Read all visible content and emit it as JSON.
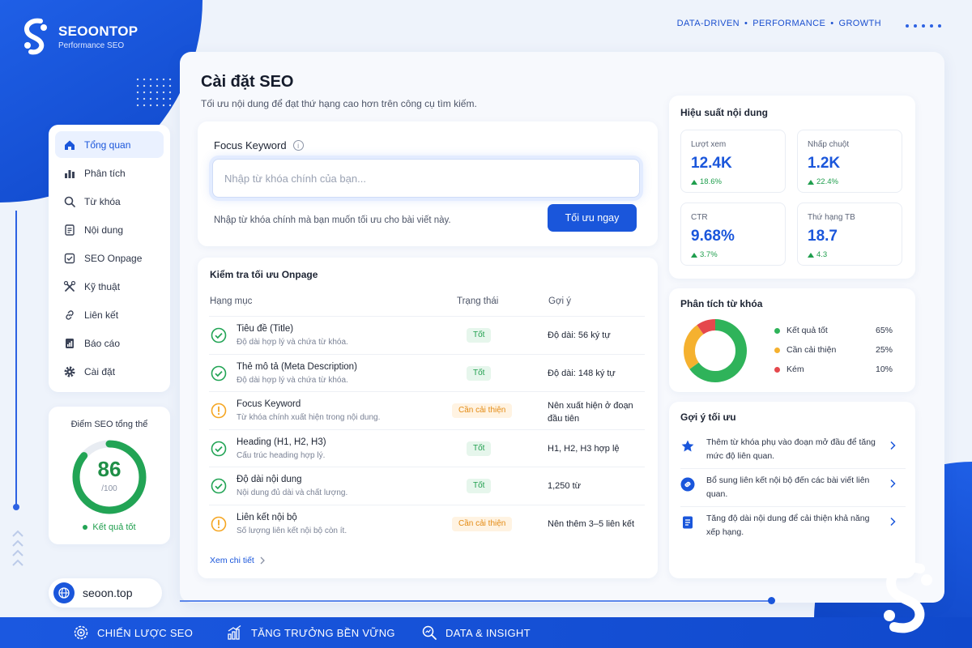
{
  "brand": {
    "name": "SEOONTOP",
    "subtitle": "Performance SEO"
  },
  "tagline": {
    "items": [
      "DATA-DRIVEN",
      "PERFORMANCE",
      "GROWTH"
    ],
    "separator": "•"
  },
  "sidebar": {
    "items": [
      {
        "label": "Tổng quan",
        "icon": "home-icon",
        "active": true
      },
      {
        "label": "Phân tích",
        "icon": "bar-chart-icon"
      },
      {
        "label": "Từ khóa",
        "icon": "search-icon"
      },
      {
        "label": "Nội dung",
        "icon": "document-icon"
      },
      {
        "label": "SEO Onpage",
        "icon": "checklist-icon"
      },
      {
        "label": "Kỹ thuật",
        "icon": "tools-icon"
      },
      {
        "label": "Liên kết",
        "icon": "link-icon"
      },
      {
        "label": "Báo cáo",
        "icon": "report-icon"
      },
      {
        "label": "Cài đặt",
        "icon": "gear-icon"
      }
    ]
  },
  "score": {
    "title": "Điểm SEO tổng thể",
    "value": "86",
    "max": "/100",
    "percent": 86,
    "status": "Kết quả tốt"
  },
  "site": {
    "label": "seoon.top"
  },
  "page": {
    "title": "Cài đặt SEO",
    "subtitle": "Tối ưu nội dung để đạt thứ hạng cao hơn trên công cụ tìm kiếm."
  },
  "keyword": {
    "label": "Focus Keyword",
    "info": "i",
    "placeholder": "Nhập từ khóa chính của bạn...",
    "value": "",
    "hint": "Nhập từ khóa chính mà bạn muốn tối ưu cho bài viết này.",
    "button": "Tối ưu ngay"
  },
  "onpage": {
    "title": "Kiểm tra tối ưu Onpage",
    "headers": {
      "item": "Hạng mục",
      "status": "Trạng thái",
      "suggestion": "Gợi ý"
    },
    "rows": [
      {
        "name": "Tiêu đề (Title)",
        "desc": "Độ dài hợp lý và chứa từ khóa.",
        "status": "Tốt",
        "state": "good",
        "hint": "Độ dài: 56 ký tự"
      },
      {
        "name": "Thẻ mô tả (Meta Description)",
        "desc": "Độ dài hợp lý và chứa từ khóa.",
        "status": "Tốt",
        "state": "good",
        "hint": "Độ dài: 148 ký tự"
      },
      {
        "name": "Focus Keyword",
        "desc": "Từ khóa chính xuất hiện trong nội dung.",
        "status": "Cần cải thiện",
        "state": "warn",
        "hint": "Nên xuất hiện ở đoạn đầu tiên"
      },
      {
        "name": "Heading (H1, H2, H3)",
        "desc": "Cấu trúc heading hợp lý.",
        "status": "Tốt",
        "state": "good",
        "hint": "H1, H2, H3 hợp lệ"
      },
      {
        "name": "Độ dài nội dung",
        "desc": "Nội dung đủ dài và chất lượng.",
        "status": "Tốt",
        "state": "good",
        "hint": "1,250 từ"
      },
      {
        "name": "Liên kết nội bộ",
        "desc": "Số lượng liên kết nội bộ còn ít.",
        "status": "Cần cải thiện",
        "state": "warn",
        "hint": "Nên thêm 3–5 liên kết"
      }
    ],
    "see_more": "Xem chi tiết"
  },
  "performance": {
    "title": "Hiệu suất nội dung",
    "stats": [
      {
        "label": "Lượt xem",
        "value": "12.4K",
        "delta": "18.6%"
      },
      {
        "label": "Nhấp chuột",
        "value": "1.2K",
        "delta": "22.4%"
      },
      {
        "label": "CTR",
        "value": "9.68%",
        "delta": "3.7%"
      },
      {
        "label": "Thứ hạng TB",
        "value": "18.7",
        "delta": "4.3"
      }
    ]
  },
  "keyword_analysis": {
    "title": "Phân tích từ khóa",
    "segments": [
      {
        "label": "Kết quả tốt",
        "pct": "65%",
        "value": 65,
        "color": "#2fb35a"
      },
      {
        "label": "Cần cải thiện",
        "pct": "25%",
        "value": 25,
        "color": "#f5b12f"
      },
      {
        "label": "Kém",
        "pct": "10%",
        "value": 10,
        "color": "#e5484d"
      }
    ]
  },
  "tips": {
    "title": "Gợi ý tối ưu",
    "items": [
      {
        "text": "Thêm từ khóa phụ vào đoạn mở đầu để tăng mức độ liên quan.",
        "icon": "star-icon"
      },
      {
        "text": "Bổ sung liên kết nội bộ đến các bài viết liên quan.",
        "icon": "link-icon"
      },
      {
        "text": "Tăng độ dài nội dung để cải thiện khả năng xếp hạng.",
        "icon": "document-icon"
      }
    ]
  },
  "footer": {
    "items": [
      "CHIẾN LƯỢC SEO",
      "TĂNG TRƯỞNG BỀN VỮNG",
      "DATA & INSIGHT"
    ]
  },
  "colors": {
    "primary": "#1a56db",
    "good": "#22a455",
    "warn": "#f5a623",
    "bad": "#e5484d"
  }
}
